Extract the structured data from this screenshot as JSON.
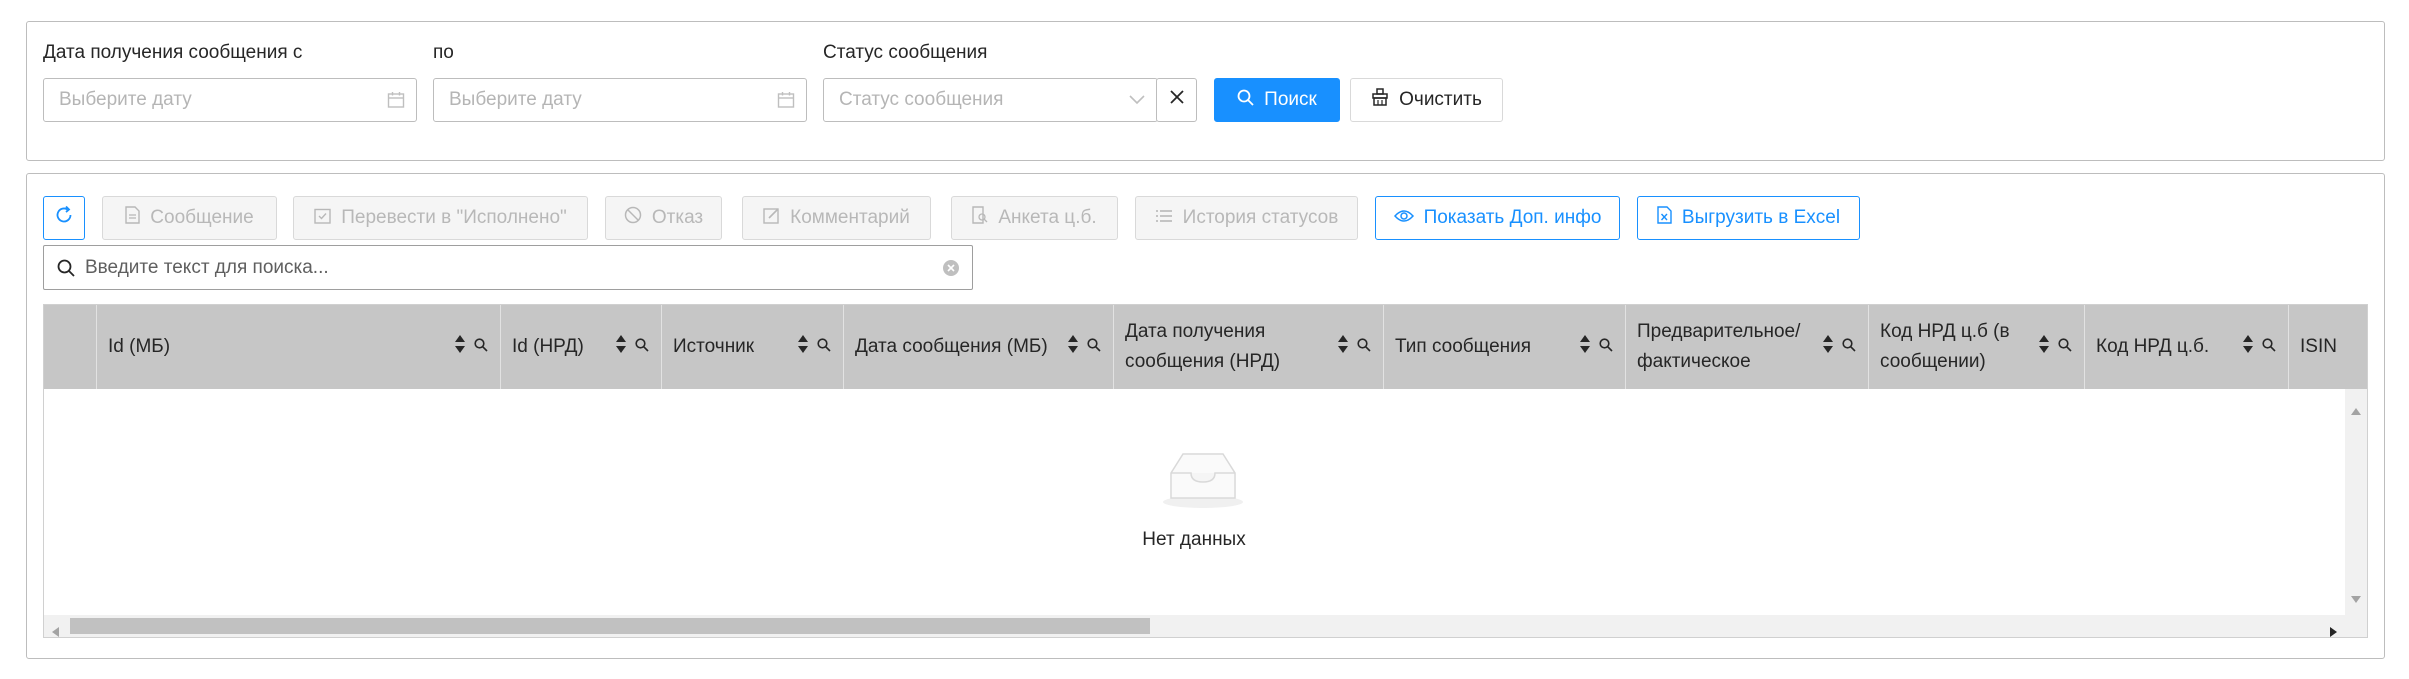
{
  "filters": {
    "date_from_label": "Дата получения сообщения с",
    "date_to_label": "по",
    "status_label": "Статус сообщения",
    "date_from_placeholder": "Выберите дату",
    "date_to_placeholder": "Выберите дату",
    "status_placeholder": "Статус сообщения",
    "search_button": "Поиск",
    "clear_button": "Очистить"
  },
  "toolbar": {
    "message": "Сообщение",
    "mark_done": "Перевести в \"Исполнено\"",
    "reject": "Отказ",
    "comment": "Комментарий",
    "security_form": "Анкета ц.б.",
    "status_history": "История статусов",
    "show_extra": "Показать Доп. инфо",
    "export_excel": "Выгрузить в Excel"
  },
  "search": {
    "placeholder": "Введите текст для поиска..."
  },
  "table": {
    "columns": [
      "Id (МБ)",
      "Id (НРД)",
      "Источник",
      "Дата сообщения (МБ)",
      "Дата получения сообщения (НРД)",
      "Тип сообщения",
      "Предварительное/ фактическое",
      "Код НРД ц.б (в сообщении)",
      "Код НРД ц.б.",
      "ISIN"
    ],
    "empty_text": "Нет данных"
  },
  "colors": {
    "primary": "#1890ff",
    "header_bg": "#c6c6c6",
    "border": "#bdbdbd"
  }
}
